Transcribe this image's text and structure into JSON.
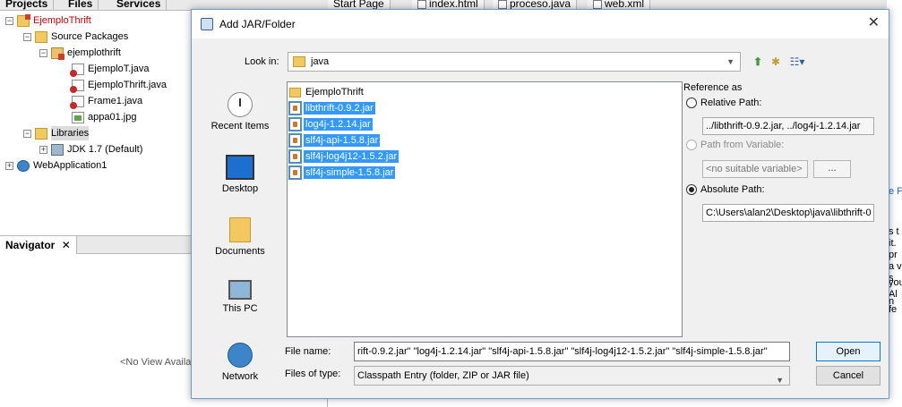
{
  "ide": {
    "top_tabs": [
      "Projects",
      "Files",
      "Services"
    ],
    "tree": [
      {
        "label": "EjemploThrift",
        "level": 0,
        "icon": "project-icon",
        "expander": "-",
        "red": true
      },
      {
        "label": "Source Packages",
        "level": 1,
        "icon": "folder-icon",
        "expander": "-"
      },
      {
        "label": "ejemplothrift",
        "level": 2,
        "icon": "package-icon",
        "expander": "-"
      },
      {
        "label": "EjemploT.java",
        "level": 3,
        "icon": "java-file-icon"
      },
      {
        "label": "EjemploThrift.java",
        "level": 3,
        "icon": "java-file-icon"
      },
      {
        "label": "Frame1.java",
        "level": 3,
        "icon": "java-file-icon"
      },
      {
        "label": "appa01.jpg",
        "level": 3,
        "icon": "image-file-icon"
      },
      {
        "label": "Libraries",
        "level": 1,
        "icon": "folder-icon",
        "expander": "-",
        "selected": true
      },
      {
        "label": "JDK 1.7 (Default)",
        "level": 2,
        "icon": "jdk-icon",
        "expander": "+"
      },
      {
        "label": "WebApplication1",
        "level": 0,
        "icon": "globe-icon",
        "expander": "+"
      }
    ],
    "navigator": {
      "tab_label": "Navigator",
      "close_glyph": "✕",
      "empty_text": "<No View Availab"
    },
    "editor_tabs": [
      "Start Page",
      "index.html",
      "proceso.java",
      "web.xml"
    ],
    "right_strip_lines": [
      "e F",
      "s t",
      "it.",
      "pr",
      "a v",
      "s",
      "you",
      "Al",
      "n",
      "fe"
    ]
  },
  "dialog": {
    "title": "Add JAR/Folder",
    "close_glyph": "✕",
    "look_in_label": "Look in:",
    "look_in_value": "java",
    "toolbar_icons": [
      "up-folder-icon",
      "new-folder-icon",
      "view-menu-icon"
    ],
    "places": [
      "Recent Items",
      "Desktop",
      "Documents",
      "This PC",
      "Network"
    ],
    "files": [
      {
        "name": "EjemploThrift",
        "type": "folder",
        "selected": false
      },
      {
        "name": "libthrift-0.9.2.jar",
        "type": "jar",
        "selected": true
      },
      {
        "name": "log4j-1.2.14.jar",
        "type": "jar",
        "selected": true
      },
      {
        "name": "slf4j-api-1.5.8.jar",
        "type": "jar",
        "selected": true
      },
      {
        "name": "slf4j-log4j12-1.5.2.jar",
        "type": "jar",
        "selected": true
      },
      {
        "name": "slf4j-simple-1.5.8.jar",
        "type": "jar",
        "selected": true
      }
    ],
    "reference": {
      "title": "Reference as",
      "relative_label": "Relative Path:",
      "relative_value": "../libthrift-0.9.2.jar, ../log4j-1.2.14.jar",
      "variable_label": "Path from Variable:",
      "variable_value": "<no suitable variable>",
      "browse_label": "...",
      "absolute_label": "Absolute Path:",
      "absolute_value": "C:\\Users\\alan2\\Desktop\\java\\libthrift-0",
      "selected": "absolute"
    },
    "file_name_label": "File name:",
    "file_name_value": "rift-0.9.2.jar\" \"log4j-1.2.14.jar\" \"slf4j-api-1.5.8.jar\" \"slf4j-log4j12-1.5.2.jar\" \"slf4j-simple-1.5.8.jar\"",
    "files_of_type_label": "Files of type:",
    "files_of_type_value": "Classpath Entry (folder, ZIP or JAR file)",
    "open_label": "Open",
    "cancel_label": "Cancel"
  }
}
